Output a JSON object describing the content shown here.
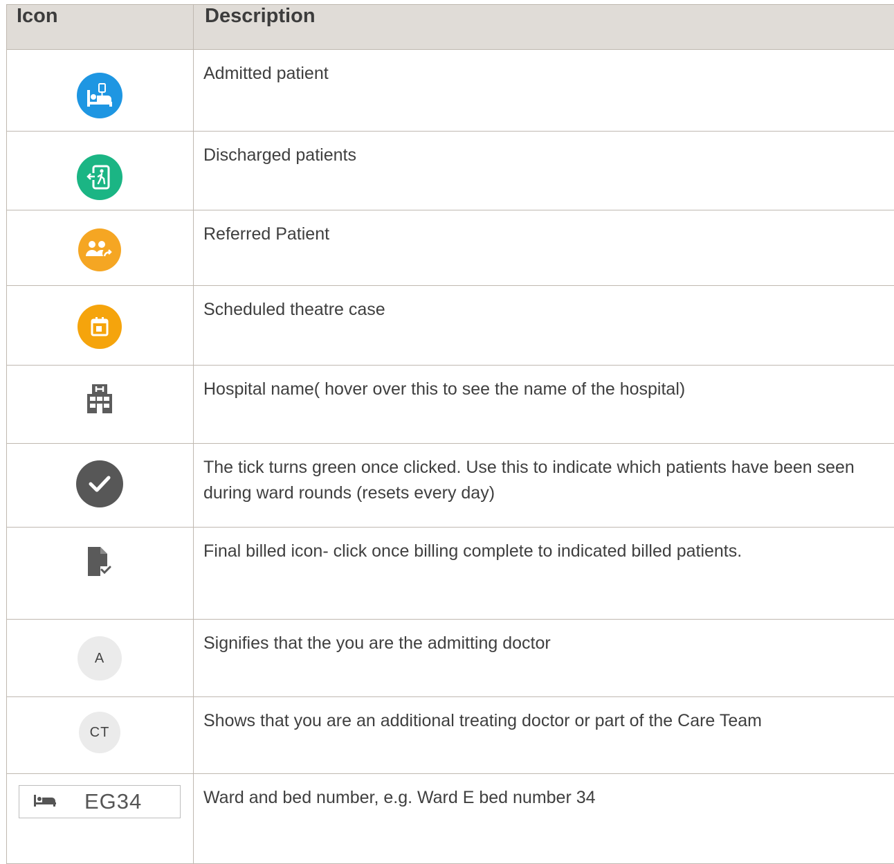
{
  "table": {
    "header": {
      "icon": "Icon",
      "description": "Description"
    },
    "rows": [
      {
        "icon": "admitted-patient-icon",
        "color": "#1e96e2",
        "description": "Admitted patient"
      },
      {
        "icon": "discharged-patient-icon",
        "color": "#1bb584",
        "description": "Discharged patients"
      },
      {
        "icon": "referred-patient-icon",
        "color": "#f5a623",
        "description": "Referred Patient"
      },
      {
        "icon": "scheduled-theatre-icon",
        "color": "#f5a40c",
        "description": "Scheduled theatre case"
      },
      {
        "icon": "hospital-icon",
        "color": "#5c5c5c",
        "description": "Hospital name( hover over this to see the name of the hospital)"
      },
      {
        "icon": "tick-icon",
        "color": "#575757",
        "description": "The tick turns green once clicked.  Use this to indicate which patients have been seen during ward rounds (resets every day)"
      },
      {
        "icon": "final-billed-icon",
        "color": "#5a5a5a",
        "description": "Final billed icon- click once billing complete to indicated billed patients."
      },
      {
        "icon": "admitting-doctor-badge",
        "label": "A",
        "description": "Signifies that the you are the admitting doctor"
      },
      {
        "icon": "care-team-badge",
        "label": "CT",
        "description": "Shows that you are an additional treating doctor or part of the Care Team"
      },
      {
        "icon": "bed-icon",
        "label": "EG34",
        "description": "Ward and bed number, e.g. Ward E bed number 34"
      }
    ]
  }
}
